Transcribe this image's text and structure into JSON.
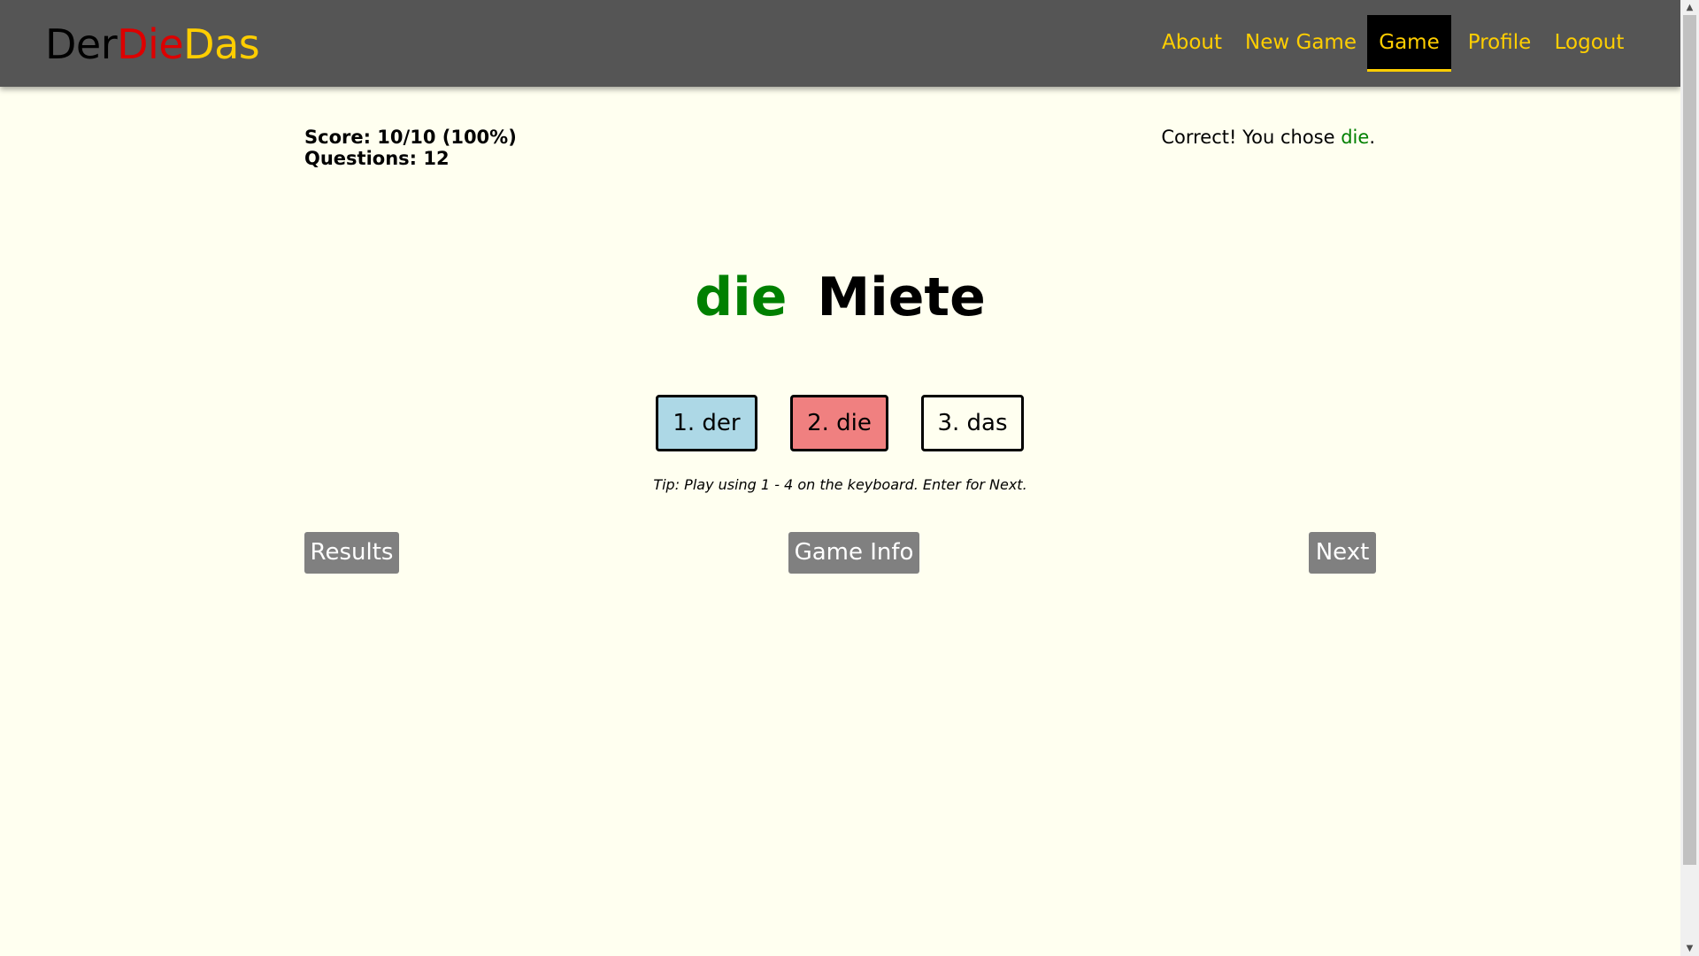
{
  "header": {
    "logo": {
      "der": "Der",
      "die": "Die",
      "das": "Das"
    },
    "nav": {
      "about": "About",
      "new_game": "New Game",
      "game": "Game",
      "profile": "Profile",
      "logout": "Logout"
    },
    "active_tab": "Game"
  },
  "game": {
    "score_line": "Score: 10/10 (100%)",
    "questions_line": "Questions: 12",
    "feedback": {
      "prefix": "Correct! You chose ",
      "choice": "die",
      "suffix": "."
    },
    "word": {
      "article": "die",
      "noun": "Miete"
    },
    "choices": [
      {
        "label": "1. der",
        "color": "#add8e6"
      },
      {
        "label": "2. die",
        "color": "#f08080"
      },
      {
        "label": "3. das",
        "color": "#fffff0"
      }
    ],
    "tip": "Tip: Play using 1 - 4 on the keyboard. Enter for Next.",
    "buttons": {
      "results": "Results",
      "game_info": "Game Info",
      "next": "Next"
    }
  },
  "colors": {
    "nav_bg": "#555555",
    "nav_text": "#ffce00",
    "page_bg": "#fffff0",
    "correct": "#008000",
    "button_bg": "#808080"
  }
}
